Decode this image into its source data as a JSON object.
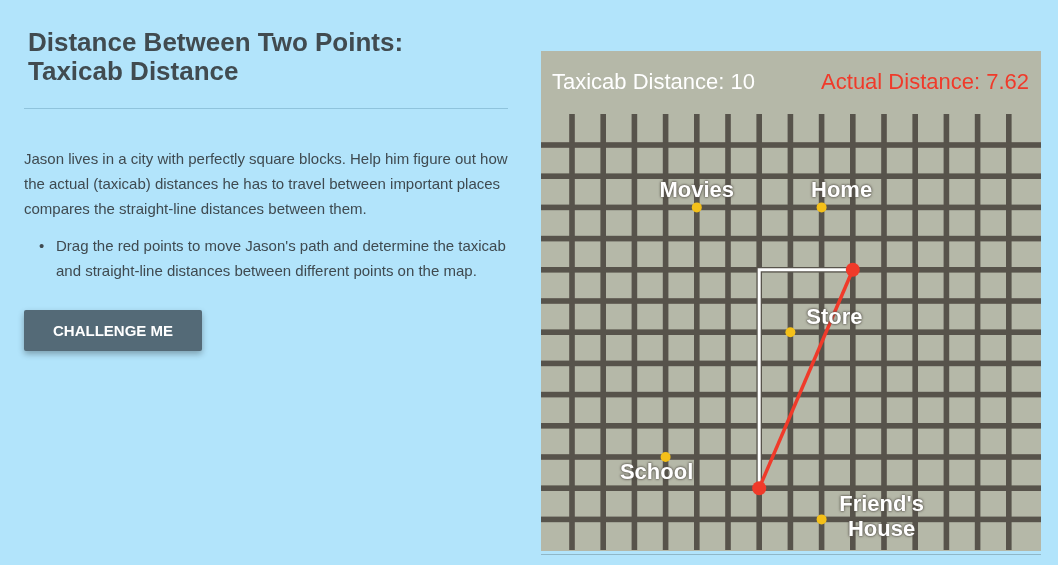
{
  "title": "Distance Between Two Points: Taxicab Distance",
  "intro": "Jason lives in a city with perfectly square blocks. Help him figure out how the actual (taxicab) distances he has to travel between important places compares the straight-line distances between them.",
  "bullets": [
    {
      "marker": "•",
      "text": "Drag the red points to move Jason's path and determine the taxicab and straight-line distances between different points on the map."
    }
  ],
  "button": "CHALLENGE ME",
  "map": {
    "taxicab": "Taxicab Distance: 10",
    "actual": "Actual Distance: 7.62",
    "places": [
      {
        "label": "Movies"
      },
      {
        "label": "Home"
      },
      {
        "label": "Store"
      },
      {
        "label": "School"
      },
      {
        "label": "Friend's House"
      }
    ]
  }
}
